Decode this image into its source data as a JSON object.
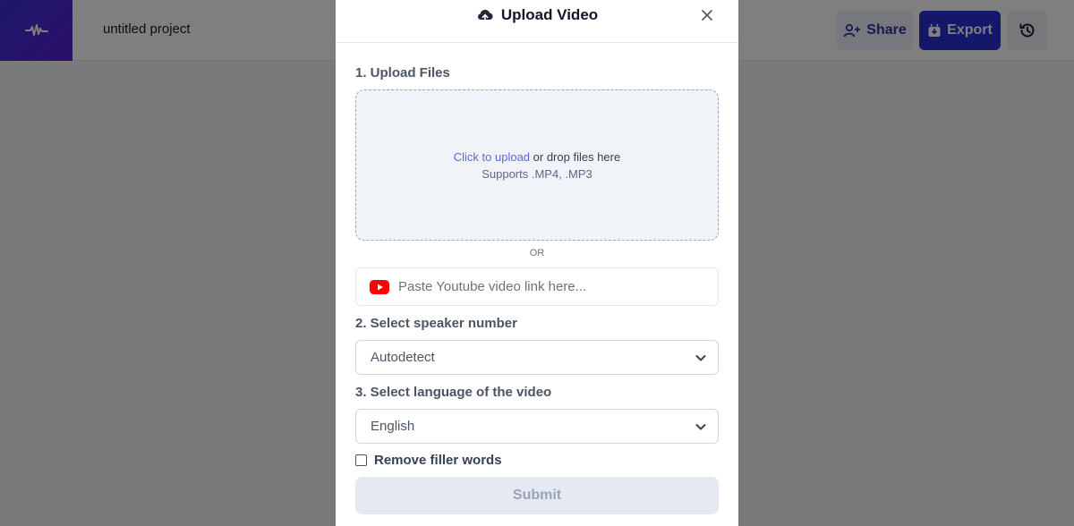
{
  "header": {
    "project_title": "untitled project",
    "share_label": "Share",
    "export_label": "Export"
  },
  "modal": {
    "title": "Upload Video",
    "section1_label": "1. Upload Files",
    "dropzone": {
      "link_text": "Click to upload",
      "rest_text": " or drop files here",
      "supports_text": "Supports .MP4, .MP3"
    },
    "or_text": "OR",
    "youtube_placeholder": "Paste Youtube video link here...",
    "section2_label": "2. Select speaker number",
    "speaker_value": "Autodetect",
    "section3_label": "3. Select language of the video",
    "language_value": "English",
    "filler_label": "Remove filler words",
    "submit_label": "Submit"
  },
  "colors": {
    "accent": "#2a2fd6",
    "youtube_red": "#ff0000",
    "overlay": "rgba(0,0,0,0.5)"
  },
  "icons": [
    "waveform-icon",
    "add-user-icon",
    "download-box-icon",
    "history-icon",
    "cloud-upload-icon",
    "close-icon",
    "youtube-icon",
    "chevron-down-icon"
  ]
}
